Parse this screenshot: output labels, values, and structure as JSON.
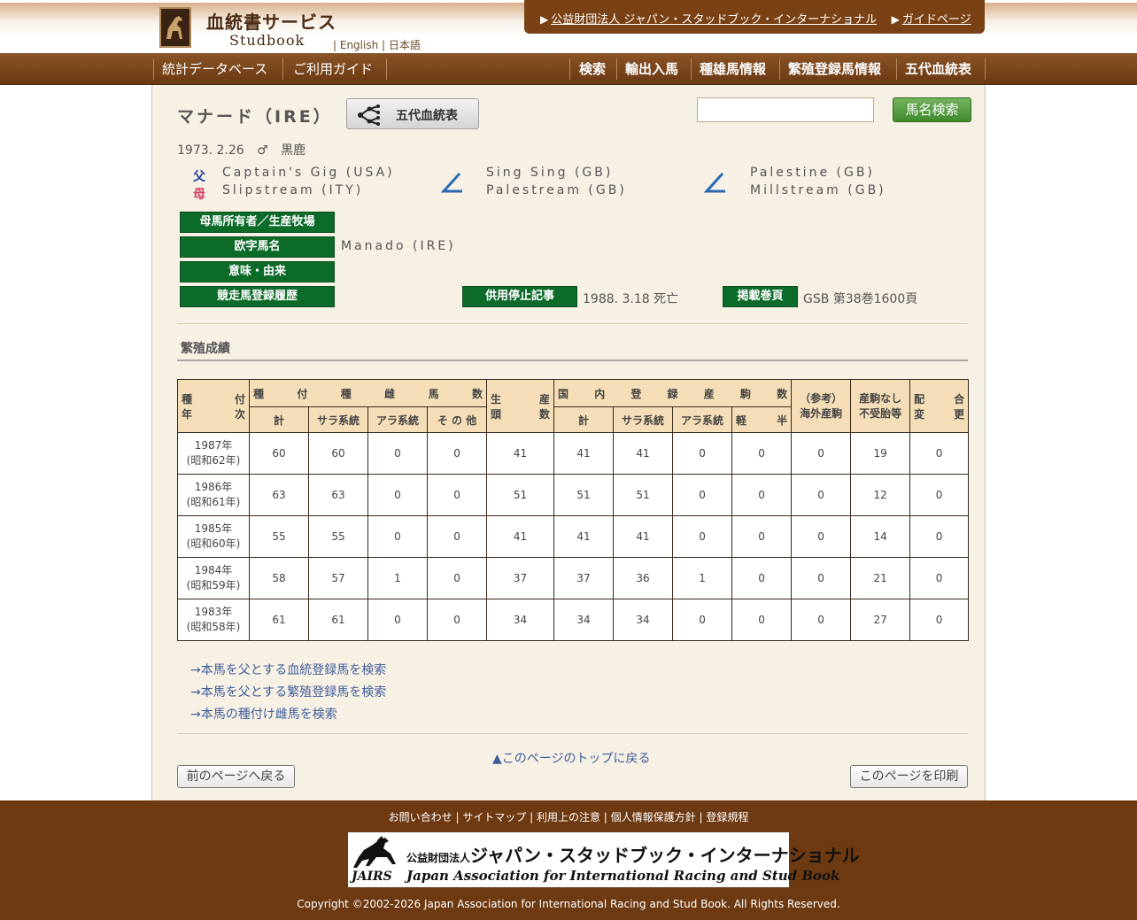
{
  "header": {
    "site_title": "血統書サービス",
    "site_subtitle": "Studbook",
    "lang_english": "English",
    "lang_japanese": "日本語",
    "org_link": "公益財団法人 ジャパン・スタッドブック・インターナショナル",
    "guide_link": "ガイドページ"
  },
  "nav": {
    "left": [
      "統計データベース",
      "ご利用ガイド"
    ],
    "right": [
      "検索",
      "輸出入馬",
      "種雄馬情報",
      "繁殖登録馬情報",
      "五代血統表"
    ]
  },
  "horse": {
    "name": "マナード（IRE）",
    "pedigree_button": "五代血統表",
    "birth_date": "1973. 2.26",
    "sex_symbol": "♂",
    "color": "黒鹿",
    "sire_label": "父",
    "dam_label": "母",
    "sire": "Captain's Gig (USA)",
    "dam": "Slipstream (ITY)",
    "sire_sire": "Sing Sing (GB)",
    "sire_dam": "Palestream (GB)",
    "dam_sire": "Palestine (GB)",
    "dam_dam": "Millstream (GB)"
  },
  "search": {
    "button": "馬名検索",
    "value": ""
  },
  "info": {
    "owner_label": "母馬所有者／生産牧場",
    "roman_name_label": "欧字馬名",
    "roman_name": "Manado (IRE)",
    "meaning_label": "意味・由来",
    "race_history_label": "競走馬登録履歴",
    "retire_label": "供用停止記事",
    "retire_value": "1988. 3.18 死亡",
    "volume_label": "掲載巻頁",
    "volume_value": "GSB 第38巻1600頁"
  },
  "breeding": {
    "section_title": "繁殖成績",
    "headers": {
      "year_a": "種",
      "year_b": "付",
      "year_c": "年",
      "year_d": "次",
      "mares_group": [
        "種",
        "付",
        "種",
        "雌",
        "馬",
        "数"
      ],
      "born_a": "生",
      "born_b": "産",
      "born_c": "頭",
      "born_d": "数",
      "domestic_group": [
        "国",
        "内",
        "登",
        "録",
        "産",
        "駒",
        "数"
      ],
      "overseas_a": "（参考）",
      "overseas_b": "海外産駒",
      "nofoal_a": "産駒なし",
      "nofoal_b": "不受胎等",
      "mix_a": "配",
      "mix_b": "合",
      "mix_c": "変",
      "mix_d": "更",
      "total": "計",
      "thoroughbred": "サラ系統",
      "arab": "アラ系統",
      "other": "そ の 他",
      "domestic_total": "計",
      "domestic_thoroughbred": "サラ系統",
      "domestic_arab": "アラ系統",
      "half_a": "軽",
      "half_b": "半"
    },
    "rows": [
      {
        "year": "1987年",
        "era": "(昭和62年)",
        "v": [
          "60",
          "60",
          "0",
          "0",
          "41",
          "41",
          "41",
          "0",
          "0",
          "0",
          "19",
          "0"
        ]
      },
      {
        "year": "1986年",
        "era": "(昭和61年)",
        "v": [
          "63",
          "63",
          "0",
          "0",
          "51",
          "51",
          "51",
          "0",
          "0",
          "0",
          "12",
          "0"
        ]
      },
      {
        "year": "1985年",
        "era": "(昭和60年)",
        "v": [
          "55",
          "55",
          "0",
          "0",
          "41",
          "41",
          "41",
          "0",
          "0",
          "0",
          "14",
          "0"
        ]
      },
      {
        "year": "1984年",
        "era": "(昭和59年)",
        "v": [
          "58",
          "57",
          "1",
          "0",
          "37",
          "37",
          "36",
          "1",
          "0",
          "0",
          "21",
          "0"
        ]
      },
      {
        "year": "1983年",
        "era": "(昭和58年)",
        "v": [
          "61",
          "61",
          "0",
          "0",
          "34",
          "34",
          "34",
          "0",
          "0",
          "0",
          "27",
          "0"
        ]
      }
    ]
  },
  "links": {
    "items": [
      "→本馬を父とする血統登録馬を検索",
      "→本馬を父とする繁殖登録馬を検索",
      "→本馬の種付け雌馬を検索"
    ],
    "page_top": "▲このページのトップに戻る",
    "back": "前のページへ戻る",
    "print": "このページを印刷"
  },
  "footer": {
    "links": "お問い合わせ | サイトマップ | 利用上の注意 | 個人情報保護方針 | 登録規程",
    "logo_prefix": "公益財団法人",
    "logo_jp": "ジャパン・スタッドブック・インターナショナル",
    "logo_en": "Japan Association for International Racing and Stud Book",
    "logo_mark": "JAIRS",
    "copyright": "Copyright ©2002-2026 Japan Association for International Racing and Stud Book. All Rights Reserved."
  }
}
